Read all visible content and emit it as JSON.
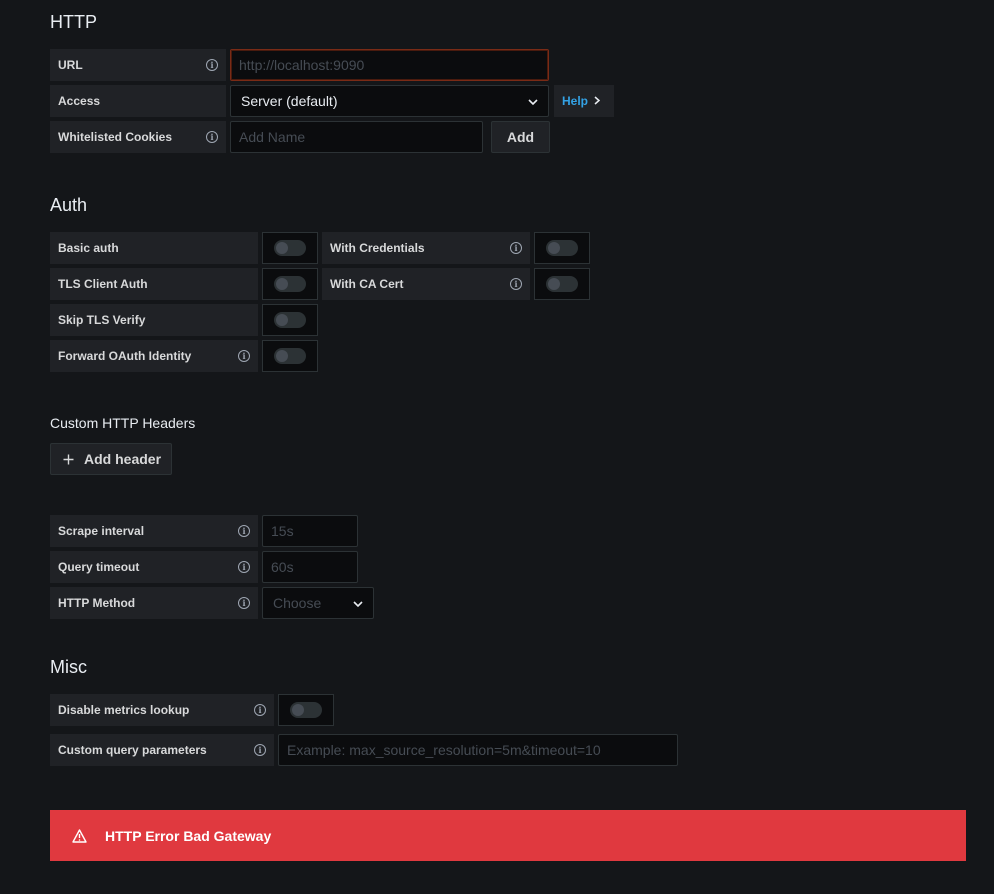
{
  "http": {
    "title": "HTTP",
    "url_label": "URL",
    "url_placeholder": "http://localhost:9090",
    "access_label": "Access",
    "access_value": "Server (default)",
    "help_label": "Help",
    "cookies_label": "Whitelisted Cookies",
    "cookies_placeholder": "Add Name",
    "add_label": "Add"
  },
  "auth": {
    "title": "Auth",
    "basic_auth": "Basic auth",
    "with_credentials": "With Credentials",
    "tls_client_auth": "TLS Client Auth",
    "with_ca_cert": "With CA Cert",
    "skip_tls_verify": "Skip TLS Verify",
    "forward_oauth": "Forward OAuth Identity"
  },
  "headers": {
    "title": "Custom HTTP Headers",
    "add_header": "Add header"
  },
  "prometheus": {
    "scrape_label": "Scrape interval",
    "scrape_placeholder": "15s",
    "timeout_label": "Query timeout",
    "timeout_placeholder": "60s",
    "method_label": "HTTP Method",
    "method_placeholder": "Choose"
  },
  "misc": {
    "title": "Misc",
    "disable_metrics": "Disable metrics lookup",
    "custom_query_label": "Custom query parameters",
    "custom_query_placeholder": "Example: max_source_resolution=5m&timeout=10"
  },
  "alert": {
    "message": "HTTP Error Bad Gateway",
    "color": "#e0393f"
  },
  "icons": {
    "info": "info-icon",
    "chevron": "chevron-down-icon",
    "plus": "plus-icon",
    "warning": "warning-icon"
  }
}
